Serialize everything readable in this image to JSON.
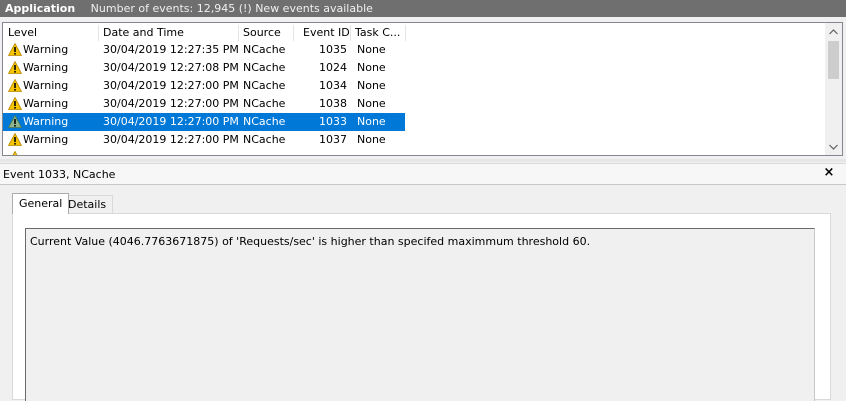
{
  "header": {
    "title": "Application",
    "events_text": "Number of events: 12,945 (!) New events available"
  },
  "columns": [
    "Level",
    "Date and Time",
    "Source",
    "Event ID",
    "Task C..."
  ],
  "events": [
    {
      "level": "Warning",
      "datetime": "30/04/2019 12:27:35 PM",
      "source": "NCache",
      "event_id": "1035",
      "task": "None"
    },
    {
      "level": "Warning",
      "datetime": "30/04/2019 12:27:08 PM",
      "source": "NCache",
      "event_id": "1024",
      "task": "None"
    },
    {
      "level": "Warning",
      "datetime": "30/04/2019 12:27:00 PM",
      "source": "NCache",
      "event_id": "1034",
      "task": "None"
    },
    {
      "level": "Warning",
      "datetime": "30/04/2019 12:27:00 PM",
      "source": "NCache",
      "event_id": "1038",
      "task": "None"
    },
    {
      "level": "Warning",
      "datetime": "30/04/2019 12:27:00 PM",
      "source": "NCache",
      "event_id": "1033",
      "task": "None"
    },
    {
      "level": "Warning",
      "datetime": "30/04/2019 12:27:00 PM",
      "source": "NCache",
      "event_id": "1037",
      "task": "None"
    }
  ],
  "selected_row": 4,
  "detail": {
    "title": "Event 1033, NCache",
    "close_glyph": "×",
    "tabs": [
      "General",
      "Details"
    ],
    "message": "Current Value (4046.7763671875)  of 'Requests/sec' is higher than specifed maximmum threshold 60."
  },
  "icons": {
    "warning": "warning-triangle-icon",
    "scroll_up": "chevron-up-icon",
    "scroll_down": "chevron-down-icon",
    "close": "close-icon"
  },
  "colors": {
    "header_bg": "#6f6f6f",
    "selection": "#0078d7",
    "warning_fill": "#f7c400"
  }
}
